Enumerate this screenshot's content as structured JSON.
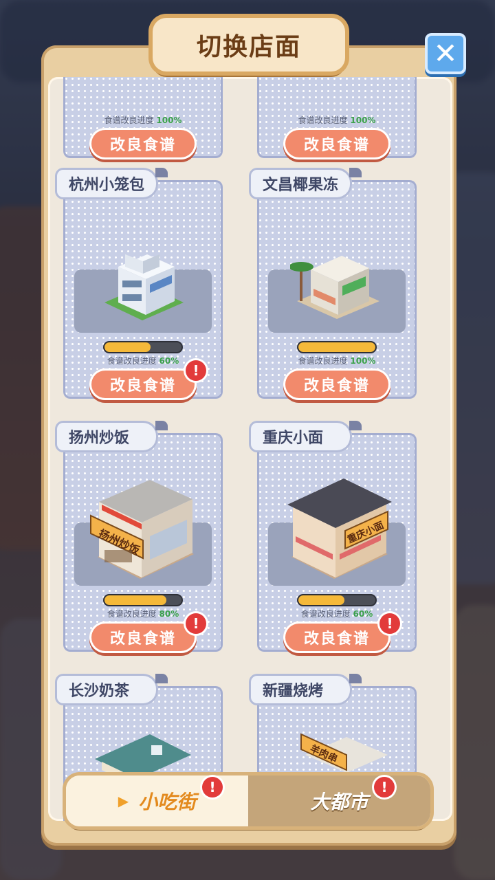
{
  "dialog": {
    "title": "切换店面",
    "close_label": "✕"
  },
  "common": {
    "progress_label": "食谱改良进度",
    "improve_button": "改良食谱",
    "alert_mark": "!"
  },
  "shops": [
    {
      "name": "",
      "progress": "100%",
      "progress_value": 1.0,
      "alert": false
    },
    {
      "name": "",
      "progress": "100%",
      "progress_value": 1.0,
      "alert": false
    },
    {
      "name": "杭州小笼包",
      "progress": "60%",
      "progress_value": 0.6,
      "alert": true
    },
    {
      "name": "文昌椰果冻",
      "progress": "100%",
      "progress_value": 1.0,
      "alert": false
    },
    {
      "name": "扬州炒饭",
      "progress": "80%",
      "progress_value": 0.8,
      "alert": true
    },
    {
      "name": "重庆小面",
      "progress": "60%",
      "progress_value": 0.6,
      "alert": true
    },
    {
      "name": "长沙奶茶"
    },
    {
      "name": "新疆烧烤"
    }
  ],
  "building_signs": {
    "yangzhou": "扬州炒饭",
    "chongqing": "重庆小面",
    "xinjiang": "羊肉串"
  },
  "tabs": [
    {
      "label": "小吃街",
      "active": true,
      "alert": true
    },
    {
      "label": "大都市",
      "active": false,
      "alert": true
    }
  ],
  "colors": {
    "accent": "#f28a6c",
    "panel": "#e9cfa2",
    "card": "#c8cfe6",
    "progress_fill": "#f5b93a"
  }
}
